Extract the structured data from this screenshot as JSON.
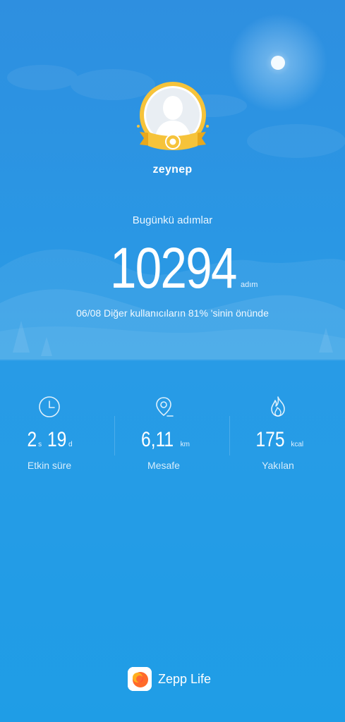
{
  "profile": {
    "username": "zeynep"
  },
  "today": {
    "label": "Bugünkü adımlar",
    "steps": "10294",
    "unit": "adım",
    "rank_text": "06/08 Diğer kullanıcıların 81% 'sinin önünde"
  },
  "stats": [
    {
      "icon": "clock-icon",
      "value_hours": "2",
      "unit_hours": "s",
      "value_minutes": "19",
      "unit_minutes": "d",
      "label": "Etkin süre"
    },
    {
      "icon": "location-pin-icon",
      "value": "6,11",
      "unit": "km",
      "label": "Mesafe"
    },
    {
      "icon": "flame-icon",
      "value": "175",
      "unit": "kcal",
      "label": "Yakılan"
    }
  ],
  "brand": {
    "name": "Zepp Life"
  },
  "colors": {
    "background": "#1f9de6",
    "badge_gold": "#f6c33a",
    "logo_orange": "#ff6a2a"
  }
}
